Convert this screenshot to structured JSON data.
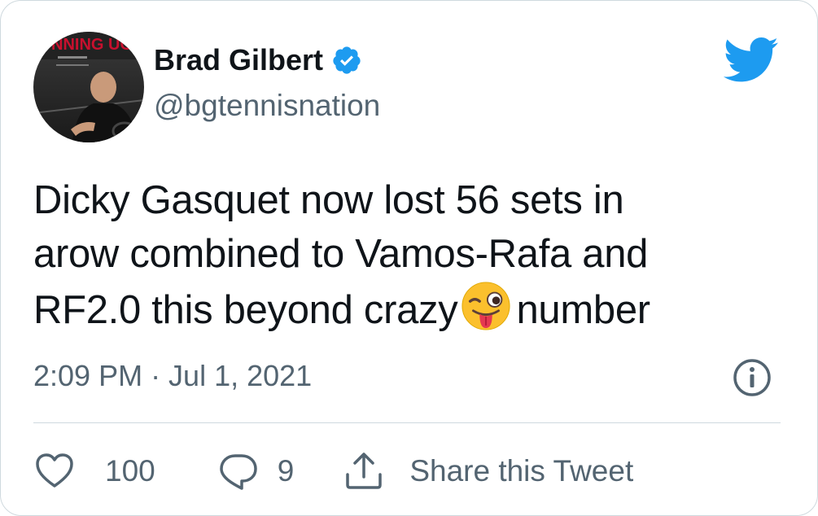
{
  "author": {
    "display_name": "Brad Gilbert",
    "handle": "@bgtennisnation",
    "verified": true,
    "avatar_banner_text": "NNING UG"
  },
  "tweet": {
    "lines": [
      "Dicky Gasquet now lost 56 sets in",
      "arow combined to Vamos-Rafa and"
    ],
    "line3_before_emoji": "RF2.0 this beyond crazy",
    "emoji": "winking-face-with-tongue",
    "line3_after_emoji": "number",
    "timestamp": "2:09 PM · Jul 1, 2021"
  },
  "actions": {
    "like_count": "100",
    "reply_count": "9",
    "share_label": "Share this Tweet"
  },
  "icons": {
    "like": "heart-icon",
    "reply": "speech-bubble-icon",
    "share": "share-icon",
    "info": "info-icon",
    "brand": "twitter-bird-icon",
    "verified": "verified-badge-icon"
  },
  "colors": {
    "twitter_blue": "#1d9bf0",
    "text_primary": "#0f1419",
    "text_secondary": "#536471",
    "border": "#cfd9de"
  }
}
